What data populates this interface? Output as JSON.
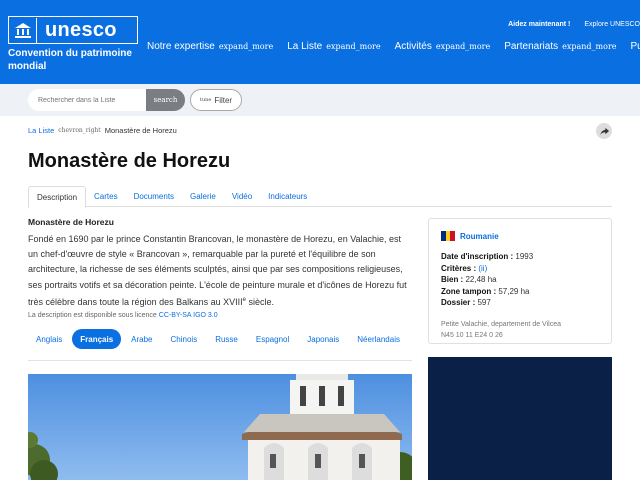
{
  "header": {
    "logo_text": "unesco",
    "site_name": "Convention du patrimoine mondial",
    "nav": [
      {
        "label": "Notre expertise",
        "icon": "expand_more"
      },
      {
        "label": "La Liste",
        "icon": "expand_more"
      },
      {
        "label": "Activités",
        "icon": "expand_more"
      },
      {
        "label": "Partenariats",
        "icon": "expand_more"
      },
      {
        "label": "Publi"
      }
    ],
    "top_links": [
      "Aidez maintenant !",
      "Explore UNESCO"
    ],
    "color": "#0a6fe0"
  },
  "search": {
    "placeholder": "Rechercher dans la Liste",
    "button_label": "search",
    "filter_icon": "tune",
    "filter_label": "Filter"
  },
  "breadcrumb": {
    "root": "La Liste",
    "separator_icon": "chevron_right",
    "current": "Monastère de Horezu"
  },
  "page": {
    "title": "Monastère de Horezu",
    "tabs": [
      "Description",
      "Cartes",
      "Documents",
      "Galerie",
      "Vidéo",
      "Indicateurs"
    ],
    "active_tab": "Description"
  },
  "description": {
    "heading": "Monastère de Horezu",
    "body_before_sup": "Fondé en 1690 par le prince Constantin Brancovan, le monastère de Horezu, en Valachie, est un chef-d'œuvre de style « Brancovan », remarquable par la pureté et l'équilibre de son architecture, la richesse de ses éléments sculptés, ainsi que par ses compositions religieuses, ses portraits votifs et sa décoration peinte. L'école de peinture murale et d'icônes de Horezu fut très célèbre dans toute la région des Balkans au XVIII",
    "sup": "e",
    "body_after_sup": " siècle.",
    "license_prefix": "La description est disponible sous licence",
    "license_link": "CC-BY-SA IGO 3.0"
  },
  "languages": {
    "items": [
      "Anglais",
      "Français",
      "Arabe",
      "Chinois",
      "Russe",
      "Espagnol",
      "Japonais",
      "Néerlandais"
    ],
    "active": "Français"
  },
  "info": {
    "country": "Roumanie",
    "flag_colors": [
      "#002b7f",
      "#fcd116",
      "#ce1126"
    ],
    "facts": [
      {
        "label": "Date d'inscription :",
        "value": "1993"
      },
      {
        "label": "Critères :",
        "value": "(ii)"
      },
      {
        "label": "Bien :",
        "value": "22,48 ha"
      },
      {
        "label": "Zone tampon :",
        "value": "57,29 ha"
      },
      {
        "label": "Dossier :",
        "value": "597"
      }
    ],
    "region": "Petite Valachie, departement de Vilcea",
    "coordinates": "N45 10 11 E24 0 26"
  }
}
